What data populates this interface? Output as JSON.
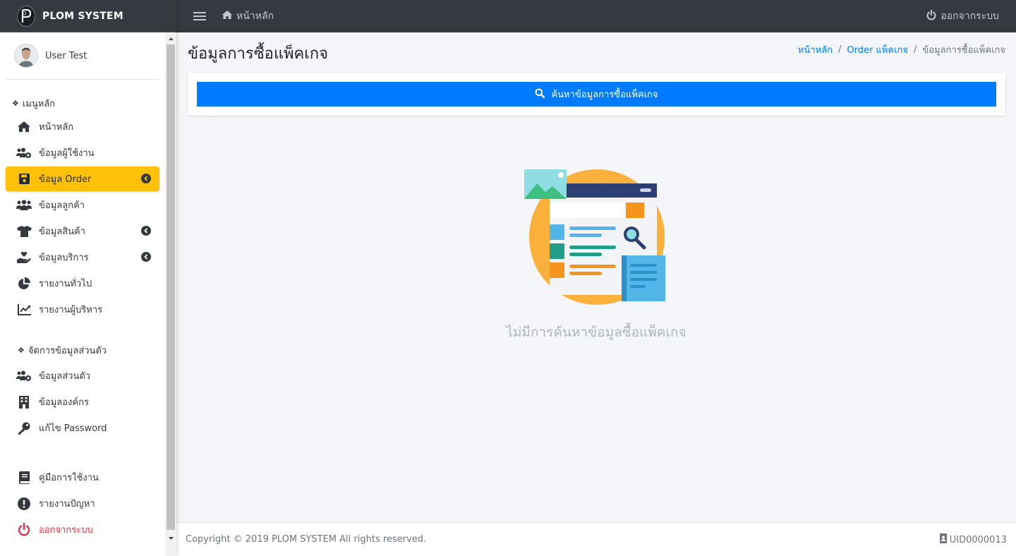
{
  "brand": {
    "name": "PLOM SYSTEM"
  },
  "user": {
    "name": "User Test"
  },
  "sidebar": {
    "main_header": "เมนูหลัก",
    "main_items": [
      {
        "label": "หน้าหลัก",
        "icon": "home-icon"
      },
      {
        "label": "ข้อมูลผู้ใช้งาน",
        "icon": "users-cog-icon"
      },
      {
        "label": "ข้อมูล Order",
        "icon": "save-icon",
        "active": true,
        "has_submenu": true
      },
      {
        "label": "ข้อมูลลูกค้า",
        "icon": "users-icon"
      },
      {
        "label": "ข้อมูลสินค้า",
        "icon": "tshirt-icon",
        "has_submenu": true
      },
      {
        "label": "ข้อมูลบริการ",
        "icon": "hand-holding-heart-icon",
        "has_submenu": true
      },
      {
        "label": "รายงานทั่วไป",
        "icon": "chart-pie-icon"
      },
      {
        "label": "รายงานผู้บริหาร",
        "icon": "chart-line-icon"
      }
    ],
    "personal_header": "จัดการข้อมูลส่วนตัว",
    "personal_items": [
      {
        "label": "ข้อมูลส่วนตัว",
        "icon": "user-cog-icon"
      },
      {
        "label": "ข้อมูลองค์กร",
        "icon": "building-icon"
      },
      {
        "label": "แก้ไข Password",
        "icon": "key-icon"
      }
    ],
    "bottom_items": [
      {
        "label": "คู่มือการใช้งาน",
        "icon": "book-icon"
      },
      {
        "label": "รายงานปัญหา",
        "icon": "exclamation-circle-icon"
      },
      {
        "label": "ออกจากระบบ",
        "icon": "power-icon"
      }
    ]
  },
  "topbar": {
    "home_label": "หน้าหลัก",
    "logout_label": "ออกจากระบบ"
  },
  "page": {
    "title": "ข้อมูลการซื้อแพ็คเกจ",
    "breadcrumb": [
      "หน้าหลัก",
      "Order แพ็คเกจ",
      "ข้อมูลการซื้อแพ็คเกจ"
    ],
    "search_button": "ค้นหาข้อมูลการซื้อแพ็คเกจ",
    "empty_message": "ไม่มีการค้นหาข้อมูลซื้อแพ็คเกจ"
  },
  "footer": {
    "copyright": "Copyright © 2019 PLOM SYSTEM All rights reserved.",
    "uid": "UID0000013"
  },
  "colors": {
    "sidebar_active": "#ffc107",
    "primary": "#007bff",
    "topbar": "#343a40",
    "danger": "#dc3545"
  }
}
